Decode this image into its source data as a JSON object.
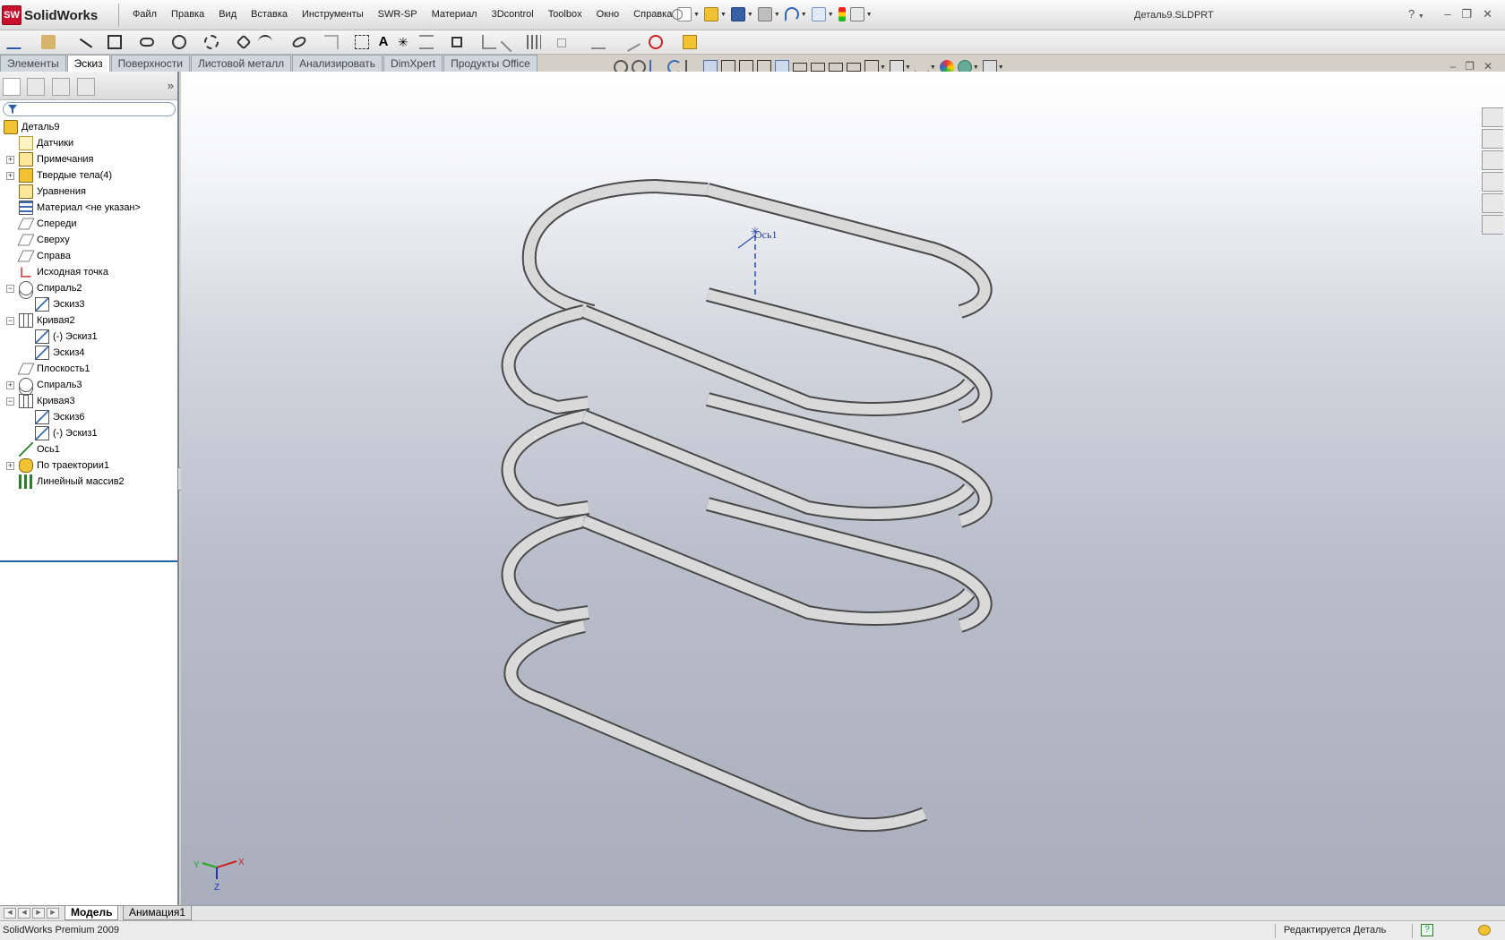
{
  "app": {
    "logo_text": "SolidWorks",
    "logo_mark": "SW",
    "document_title": "Деталь9.SLDPRT",
    "help_symbol": "?",
    "window_controls": [
      "–",
      "❐",
      "✕"
    ]
  },
  "menu": [
    "Файл",
    "Правка",
    "Вид",
    "Вставка",
    "Инструменты",
    "SWR-SP",
    "Материал",
    "3Dcontrol",
    "Toolbox",
    "Окно",
    "Справка"
  ],
  "tabs": [
    {
      "label": "Элементы",
      "active": false
    },
    {
      "label": "Эскиз",
      "active": true
    },
    {
      "label": "Поверхности",
      "active": false
    },
    {
      "label": "Листовой металл",
      "active": false
    },
    {
      "label": "Анализировать",
      "active": false
    },
    {
      "label": "DimXpert",
      "active": false
    },
    {
      "label": "Продукты Office",
      "active": false
    }
  ],
  "panel": {
    "expand_symbol": "»",
    "tree": [
      {
        "label": "Деталь9",
        "icon": "part-icon",
        "level": 0,
        "expander": ""
      },
      {
        "label": "Датчики",
        "icon": "sensor-icon",
        "level": 1,
        "expander": ""
      },
      {
        "label": "Примечания",
        "icon": "annotation-icon",
        "level": 1,
        "expander": "+"
      },
      {
        "label": "Твердые тела(4)",
        "icon": "solid-bodies-icon",
        "level": 1,
        "expander": "+"
      },
      {
        "label": "Уравнения",
        "icon": "equations-icon",
        "level": 1,
        "expander": ""
      },
      {
        "label": "Материал <не указан>",
        "icon": "material-icon",
        "level": 1,
        "expander": ""
      },
      {
        "label": "Спереди",
        "icon": "plane-icon",
        "level": 1,
        "expander": ""
      },
      {
        "label": "Сверху",
        "icon": "plane-icon",
        "level": 1,
        "expander": ""
      },
      {
        "label": "Справа",
        "icon": "plane-icon",
        "level": 1,
        "expander": ""
      },
      {
        "label": "Исходная точка",
        "icon": "origin-icon",
        "level": 1,
        "expander": ""
      },
      {
        "label": "Спираль2",
        "icon": "helix-icon",
        "level": 1,
        "expander": "−"
      },
      {
        "label": "Эскиз3",
        "icon": "sketch-icon",
        "level": 2,
        "expander": ""
      },
      {
        "label": "Кривая2",
        "icon": "curve-icon",
        "level": 1,
        "expander": "−"
      },
      {
        "label": "(-) Эскиз1",
        "icon": "sketch-icon",
        "level": 2,
        "expander": ""
      },
      {
        "label": "Эскиз4",
        "icon": "sketch-icon",
        "level": 2,
        "expander": ""
      },
      {
        "label": "Плоскость1",
        "icon": "plane-icon",
        "level": 1,
        "expander": ""
      },
      {
        "label": "Спираль3",
        "icon": "helix-icon",
        "level": 1,
        "expander": "+"
      },
      {
        "label": "Кривая3",
        "icon": "curve-icon",
        "level": 1,
        "expander": "−"
      },
      {
        "label": "Эскиз6",
        "icon": "sketch-icon",
        "level": 2,
        "expander": ""
      },
      {
        "label": "(-) Эскиз1",
        "icon": "sketch-icon",
        "level": 2,
        "expander": ""
      },
      {
        "label": "Ось1",
        "icon": "axis-icon",
        "level": 1,
        "expander": ""
      },
      {
        "label": "По траектории1",
        "icon": "sweep-icon",
        "level": 1,
        "expander": "+"
      },
      {
        "label": "Линейный массив2",
        "icon": "linear-pattern-icon",
        "level": 1,
        "expander": ""
      }
    ]
  },
  "viewport": {
    "axis_label": "Ось1",
    "triad": {
      "x": "X",
      "y": "Y",
      "z": "Z"
    },
    "colors": {
      "model_top": "#d9d9d9",
      "model_side": "#9b9b9b",
      "edge": "#4a4a4a"
    }
  },
  "bottom_tabs": [
    {
      "label": "Модель",
      "active": true
    },
    {
      "label": "Анимация1",
      "active": false
    }
  ],
  "status": {
    "left": "SolidWorks Premium 2009",
    "right": "Редактируется Деталь"
  }
}
